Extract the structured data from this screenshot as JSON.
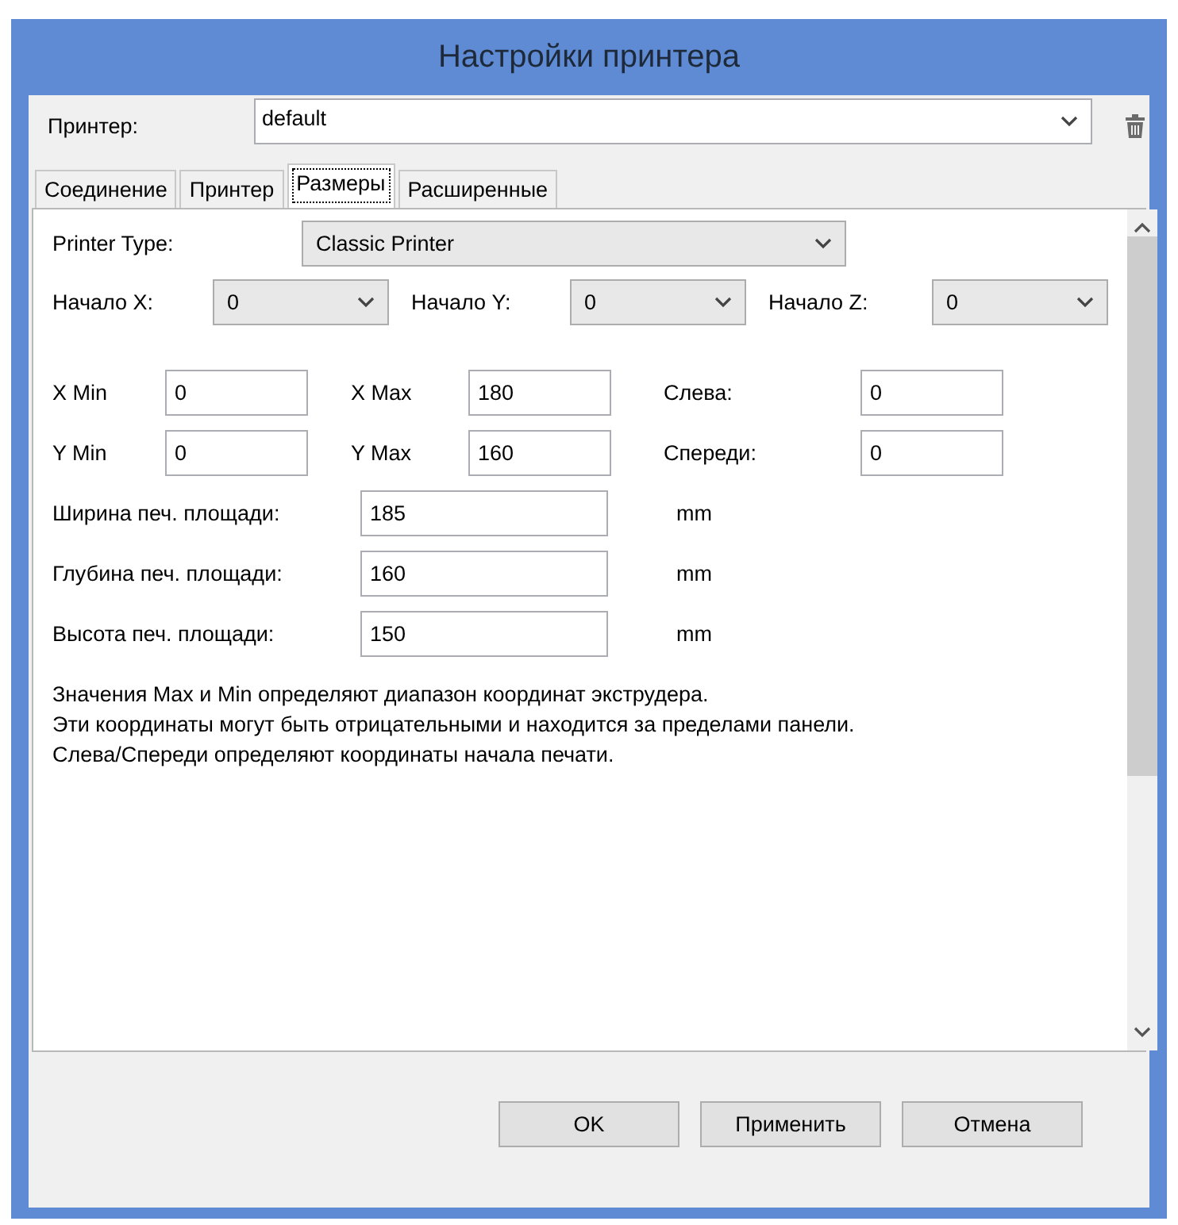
{
  "window": {
    "title": "Настройки принтера"
  },
  "printer": {
    "label": "Принтер:",
    "value": "default"
  },
  "tabs": [
    {
      "label": "Соединение",
      "selected": false
    },
    {
      "label": "Принтер",
      "selected": false
    },
    {
      "label": "Размеры",
      "selected": true
    },
    {
      "label": "Расширенные",
      "selected": false
    }
  ],
  "printer_type": {
    "label": "Printer Type:",
    "value": "Classic Printer"
  },
  "origins": [
    {
      "label": "Начало X:",
      "value": "0"
    },
    {
      "label": "Начало Y:",
      "value": "0"
    },
    {
      "label": "Начало Z:",
      "value": "0"
    }
  ],
  "limits": [
    [
      {
        "label": "X Min",
        "value": "0"
      },
      {
        "label": "X Max",
        "value": "180"
      },
      {
        "label": "Слева:",
        "value": "0"
      }
    ],
    [
      {
        "label": "Y Min",
        "value": "0"
      },
      {
        "label": "Y Max",
        "value": "160"
      },
      {
        "label": "Спереди:",
        "value": "0"
      }
    ]
  ],
  "bed": [
    {
      "label": "Ширина печ. площади:",
      "value": "185",
      "unit": "mm"
    },
    {
      "label": "Глубина печ. площади:",
      "value": "160",
      "unit": "mm"
    },
    {
      "label": "Высота печ. площади:",
      "value": "150",
      "unit": "mm"
    }
  ],
  "note": [
    "Значения Max и Min определяют диапазон координат экструдера.",
    "Эти координаты могут быть отрицательными и находится за пределами панели.",
    "Слева/Спереди определяют координаты начала печати."
  ],
  "buttons": [
    "OK",
    "Применить",
    "Отмена"
  ]
}
